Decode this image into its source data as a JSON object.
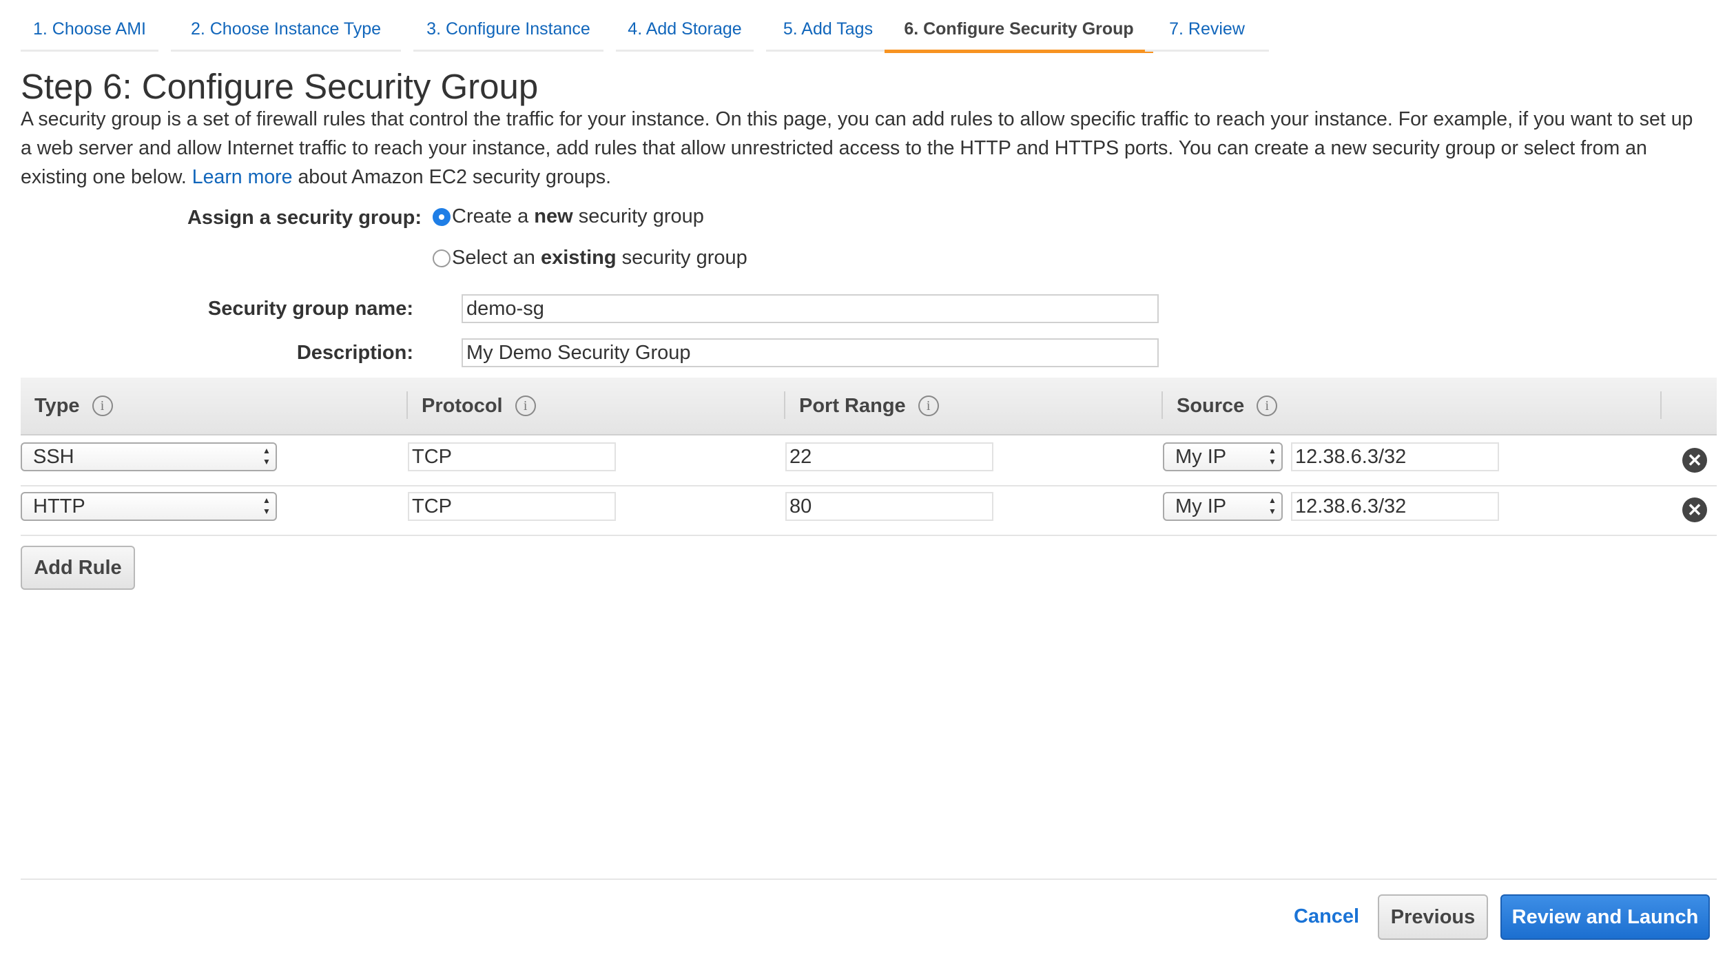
{
  "wizard": {
    "tabs": [
      {
        "label": "1. Choose AMI"
      },
      {
        "label": "2. Choose Instance Type"
      },
      {
        "label": "3. Configure Instance"
      },
      {
        "label": "4. Add Storage"
      },
      {
        "label": "5. Add Tags"
      },
      {
        "label": "6. Configure Security Group",
        "active": true
      },
      {
        "label": "7. Review"
      }
    ]
  },
  "page": {
    "title": "Step 6: Configure Security Group",
    "description": "A security group is a set of firewall rules that control the traffic for your instance. On this page, you can add rules to allow specific traffic to reach your instance. For example, if you want to set up a web server and allow Internet traffic to reach your instance, add rules that allow unrestricted access to the HTTP and HTTPS ports. You can create a new security group or select from an existing one below.",
    "learn_more": "Learn more",
    "learn_more_suffix": "about Amazon EC2 security groups."
  },
  "form": {
    "assign_label": "Assign a security group:",
    "option_new": {
      "prefix": "Create a ",
      "bold": "new",
      "suffix": " security group",
      "selected": true
    },
    "option_existing": {
      "prefix": "Select an ",
      "bold": "existing",
      "suffix": " security group",
      "selected": false
    },
    "name_label": "Security group name:",
    "name_value": "demo-sg",
    "description_label": "Description:",
    "description_value": "My Demo Security Group"
  },
  "rules": {
    "headers": {
      "type": "Type",
      "protocol": "Protocol",
      "port_range": "Port Range",
      "source": "Source"
    },
    "rows": [
      {
        "type": "SSH",
        "protocol": "TCP",
        "port_range": "22",
        "source_type": "My IP",
        "source_cidr": "12.38.6.3/32"
      },
      {
        "type": "HTTP",
        "protocol": "TCP",
        "port_range": "80",
        "source_type": "My IP",
        "source_cidr": "12.38.6.3/32"
      }
    ],
    "add_rule": "Add Rule",
    "info_glyph": "i",
    "remove_glyph": "✕"
  },
  "footer": {
    "cancel": "Cancel",
    "previous": "Previous",
    "review_launch": "Review and Launch"
  },
  "colors": {
    "link": "#1166bb",
    "active_tab_underline": "#f79321",
    "primary_button": "#1c6fd0"
  }
}
